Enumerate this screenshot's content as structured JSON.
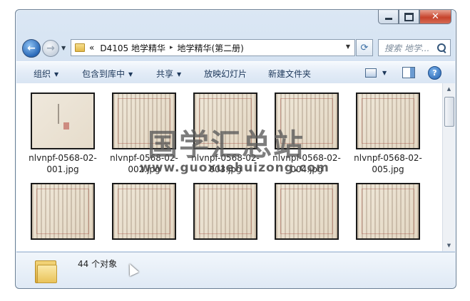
{
  "addressbar": {
    "overflow_chevron": "«",
    "crumbs": [
      "D4105 地学精华",
      "地学精华(第二册)"
    ],
    "separator": "▸"
  },
  "search": {
    "placeholder": "搜索 地学..."
  },
  "toolbar": {
    "organize": "组织",
    "include_in_library": "包含到库中",
    "share": "共享",
    "slideshow": "放映幻灯片",
    "new_folder": "新建文件夹"
  },
  "files": {
    "row1": [
      {
        "name": "nlvnpf-0568-02-001.jpg",
        "kind": "cover"
      },
      {
        "name": "nlvnpf-0568-02-002.jpg",
        "kind": "text"
      },
      {
        "name": "nlvnpf-0568-02-003.jpg",
        "kind": "text"
      },
      {
        "name": "nlvnpf-0568-02-004.jpg",
        "kind": "text"
      },
      {
        "name": "nlvnpf-0568-02-005.jpg",
        "kind": "text"
      }
    ],
    "row2_count": 5
  },
  "watermark": {
    "text": "国学汇总站",
    "url": "www.guoxuehuizong.com"
  },
  "details": {
    "count": "44 个对象"
  },
  "icons": [
    "back-icon",
    "forward-icon",
    "folder-icon",
    "refresh-icon",
    "search-icon",
    "views-icon",
    "preview-pane-icon",
    "help-icon"
  ]
}
